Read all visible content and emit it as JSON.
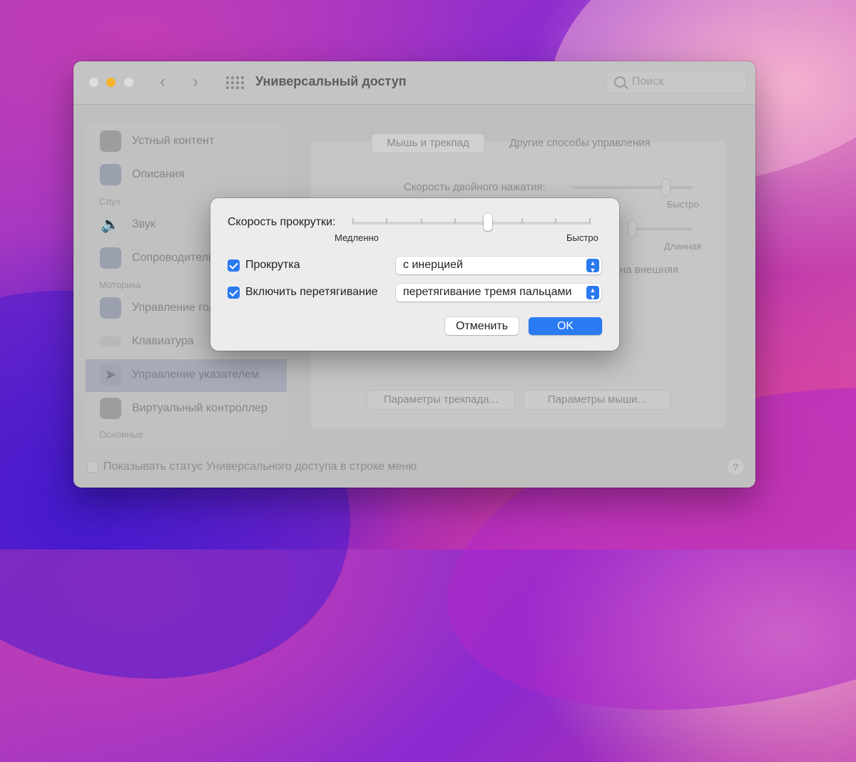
{
  "window": {
    "title": "Универсальный доступ",
    "search_placeholder": "Поиск"
  },
  "sidebar": {
    "items": [
      {
        "label": "Устный контент",
        "icon": "speech-bubble-icon"
      },
      {
        "label": "Описания",
        "icon": "chat-bubble-icon"
      },
      {
        "label": "Звук",
        "icon": "speaker-icon"
      },
      {
        "label": "Сопроводительные",
        "icon": "captions-icon"
      },
      {
        "label": "Управление голосом",
        "icon": "voice-control-icon"
      },
      {
        "label": "Клавиатура",
        "icon": "keyboard-icon"
      },
      {
        "label": "Управление указателем",
        "icon": "pointer-icon"
      },
      {
        "label": "Виртуальный контроллер",
        "icon": "switch-control-icon"
      }
    ],
    "headers": [
      "Слух",
      "Моторика",
      "Основные"
    ]
  },
  "tabs": [
    "Мышь и трекпад",
    "Другие способы управления"
  ],
  "background_settings": {
    "double_click_label": "Скорость двойного нажатия:",
    "double_click_max": "Быстро",
    "spring_max": "Длинная",
    "ignore_fragment": "на внешняя",
    "trackpad_button": "Параметры трекпада...",
    "mouse_button": "Параметры мыши..."
  },
  "footer": {
    "status_label": "Показывать статус Универсального доступа в строке меню",
    "help": "?"
  },
  "dialog": {
    "scroll_speed_label": "Скорость прокрутки:",
    "scroll_speed_min": "Медленно",
    "scroll_speed_max": "Быстро",
    "scroll_speed_value": 0.57,
    "scroll": {
      "label": "Прокрутка",
      "checked": true,
      "option": "с инерцией"
    },
    "drag": {
      "label": "Включить перетягивание",
      "checked": true,
      "option": "перетягивание тремя пальцами"
    },
    "cancel_label": "Отменить",
    "ok_label": "OK"
  },
  "colors": {
    "accent": "#2a7bf2",
    "dialog_bg": "#ececec",
    "window_dimmed": "#bfbfbf"
  }
}
